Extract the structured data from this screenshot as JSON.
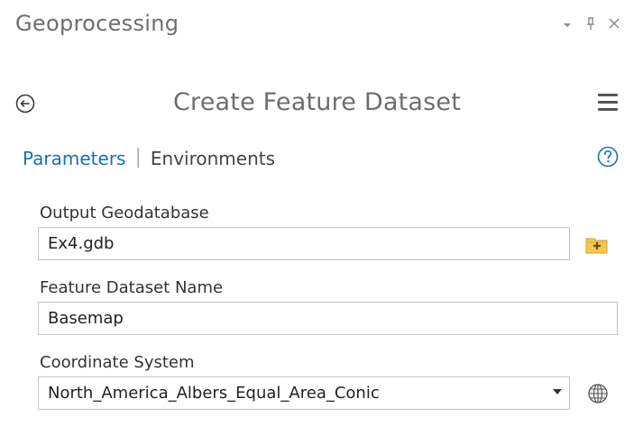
{
  "pane": {
    "title": "Geoprocessing",
    "controls": {
      "options": "▾",
      "pin": "ꟷ",
      "close": "✕"
    }
  },
  "tool": {
    "title": "Create Feature Dataset"
  },
  "tabs": {
    "parameters": "Parameters",
    "environments": "Environments"
  },
  "fields": {
    "output_gdb": {
      "label": "Output Geodatabase",
      "value": "Ex4.gdb"
    },
    "dataset_name": {
      "label": "Feature Dataset Name",
      "value": "Basemap"
    },
    "coord_system": {
      "label": "Coordinate System",
      "value": "North_America_Albers_Equal_Area_Conic"
    }
  },
  "colors": {
    "accent": "#1a6fb8",
    "folder": "#f4c84d"
  },
  "icons": [
    "options-dropdown-icon",
    "pin-icon",
    "close-icon",
    "back-arrow-icon",
    "hamburger-menu-icon",
    "help-icon",
    "browse-folder-icon",
    "globe-icon"
  ]
}
